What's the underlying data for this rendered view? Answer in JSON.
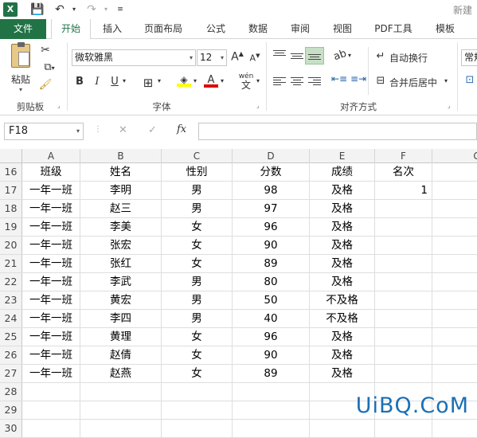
{
  "app": {
    "logo": "X",
    "title": "新建"
  },
  "tabs": {
    "file": "文件",
    "items": [
      "开始",
      "插入",
      "页面布局",
      "公式",
      "数据",
      "审阅",
      "视图",
      "PDF工具",
      "模板"
    ]
  },
  "ribbon": {
    "clipboard": {
      "paste": "粘贴",
      "group": "剪贴板"
    },
    "font": {
      "name": "微软雅黑",
      "size": "12",
      "bold": "B",
      "italic": "I",
      "underline": "U",
      "phonetic": "wén",
      "group": "字体"
    },
    "alignment": {
      "wrap": "自动换行",
      "merge": "合并后居中",
      "group": "对齐方式"
    },
    "number": {
      "format": "常规"
    }
  },
  "formula_bar": {
    "name_box": "F18",
    "fx": "fx",
    "cancel": "✕",
    "enter": "✓",
    "value": ""
  },
  "sheet": {
    "columns": [
      "A",
      "B",
      "C",
      "D",
      "E",
      "F",
      "G"
    ],
    "rows": [
      {
        "num": "16",
        "cells": [
          "班级",
          "姓名",
          "性别",
          "分数",
          "成绩",
          "名次"
        ]
      },
      {
        "num": "17",
        "cells": [
          "一年一班",
          "李明",
          "男",
          "98",
          "及格",
          "1"
        ]
      },
      {
        "num": "18",
        "cells": [
          "一年一班",
          "赵三",
          "男",
          "97",
          "及格",
          ""
        ]
      },
      {
        "num": "19",
        "cells": [
          "一年一班",
          "李美",
          "女",
          "96",
          "及格",
          ""
        ]
      },
      {
        "num": "20",
        "cells": [
          "一年一班",
          "张宏",
          "女",
          "90",
          "及格",
          ""
        ]
      },
      {
        "num": "21",
        "cells": [
          "一年一班",
          "张红",
          "女",
          "89",
          "及格",
          ""
        ]
      },
      {
        "num": "22",
        "cells": [
          "一年一班",
          "李武",
          "男",
          "80",
          "及格",
          ""
        ]
      },
      {
        "num": "23",
        "cells": [
          "一年一班",
          "黄宏",
          "男",
          "50",
          "不及格",
          ""
        ]
      },
      {
        "num": "24",
        "cells": [
          "一年一班",
          "李四",
          "男",
          "40",
          "不及格",
          ""
        ]
      },
      {
        "num": "25",
        "cells": [
          "一年一班",
          "黄理",
          "女",
          "96",
          "及格",
          ""
        ]
      },
      {
        "num": "26",
        "cells": [
          "一年一班",
          "赵倩",
          "女",
          "90",
          "及格",
          ""
        ]
      },
      {
        "num": "27",
        "cells": [
          "一年一班",
          "赵燕",
          "女",
          "89",
          "及格",
          ""
        ]
      },
      {
        "num": "28",
        "cells": [
          "",
          "",
          "",
          "",
          "",
          ""
        ]
      },
      {
        "num": "29",
        "cells": [
          "",
          "",
          "",
          "",
          "",
          ""
        ]
      },
      {
        "num": "30",
        "cells": [
          "",
          "",
          "",
          "",
          "",
          ""
        ]
      }
    ]
  },
  "watermark": "UiBQ.CoM",
  "colors": {
    "brand": "#217346",
    "watermark": "#1a6fb5"
  }
}
